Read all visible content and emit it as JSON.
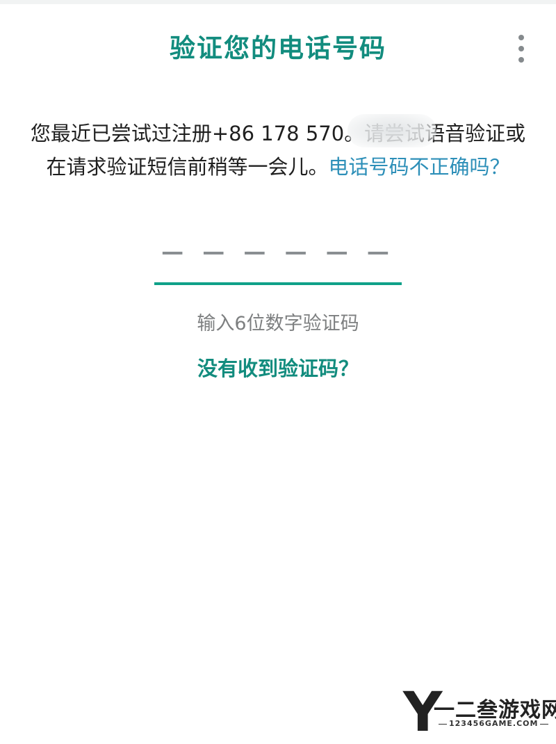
{
  "header": {
    "title": "验证您的电话号码",
    "menu_icon": "more-vertical-icon"
  },
  "message": {
    "text_before": "您最近已尝试过注册+86 178 57",
    "text_after": "0。请尝试语音验证或在请求验证短信前稍等一会儿。",
    "link": "电话号码不正确吗？"
  },
  "code_input": {
    "placeholder": "— — —   — — —",
    "digit_count": 6
  },
  "hint": "输入6位数字验证码",
  "resend_link": "没有收到验证码？",
  "watermark": {
    "letter": "Y",
    "title": "一二叁游戏网",
    "subtitle": "123456GAME.COM"
  },
  "colors": {
    "accent": "#128c7e",
    "link": "#2d8fb8",
    "underline": "#0fa189"
  }
}
